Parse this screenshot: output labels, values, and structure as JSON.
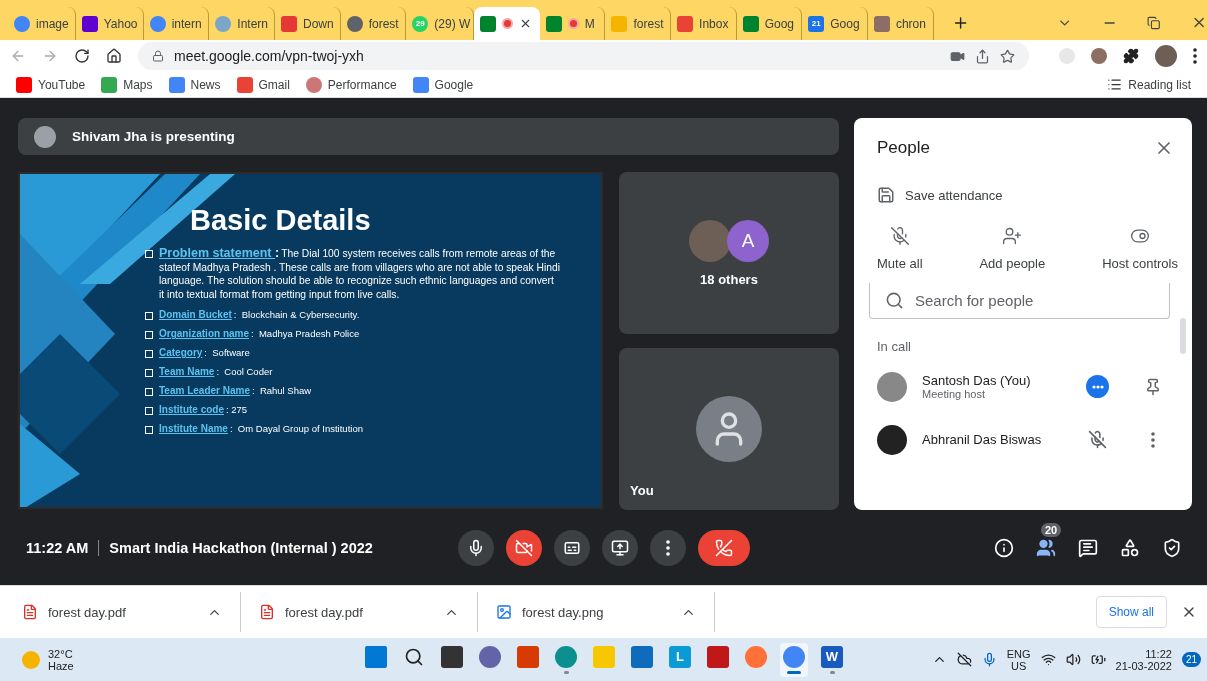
{
  "browser": {
    "tabs": [
      {
        "label": "image",
        "selected": false,
        "recording": false
      },
      {
        "label": "Yahoo",
        "selected": false,
        "recording": false
      },
      {
        "label": "intern",
        "selected": false,
        "recording": false
      },
      {
        "label": "Intern",
        "selected": false,
        "recording": false
      },
      {
        "label": "Down",
        "selected": false,
        "recording": false
      },
      {
        "label": "forest",
        "selected": false,
        "recording": false
      },
      {
        "label": "(29) W",
        "favicon_text": "29",
        "selected": false,
        "recording": false
      },
      {
        "selected": true,
        "recording": true
      },
      {
        "label": "M",
        "selected": false,
        "recording": true
      },
      {
        "label": "forest",
        "selected": false,
        "recording": false
      },
      {
        "label": "Inbox",
        "selected": false,
        "recording": false
      },
      {
        "label": "Goog",
        "selected": false,
        "recording": false
      },
      {
        "label": "Goog",
        "favicon_text": "21",
        "selected": false,
        "recording": false
      },
      {
        "label": "chron",
        "selected": false,
        "recording": false
      }
    ],
    "url": "meet.google.com/vpn-twoj-yxh",
    "bookmarks": [
      {
        "label": "YouTube"
      },
      {
        "label": "Maps"
      },
      {
        "label": "News"
      },
      {
        "label": "Gmail"
      },
      {
        "label": "Performance"
      },
      {
        "label": "Google"
      }
    ],
    "reading_list": "Reading list"
  },
  "meet": {
    "presenter_bar": "Shivam Jha is presenting",
    "slide": {
      "title": "Basic Details",
      "problem_label": "Problem statement ",
      "problem_sep": ":",
      "problem_text": "The Dial 100 system receives calls from remote areas of the stateof Madhya Pradesh . These calls are from villagers who are not able to speak Hindi language. The solution should be able to recognize such ethnic languages and convert it into textual format from getting input from live calls.",
      "fields": [
        {
          "label": "Domain Bucket",
          "value": ":  Blockchain & Cybersecurity."
        },
        {
          "label": "Organization name",
          "value": ":  Madhya Pradesh Police"
        },
        {
          "label": "Category",
          "value": ":  Software"
        },
        {
          "label": "Team Name",
          "value": ":  Cool Coder"
        },
        {
          "label": "Team Leader Name ",
          "value": ":  Rahul Shaw"
        },
        {
          "label": "Institute code",
          "value": ": 275"
        },
        {
          "label": "Institute Name",
          "value": ":  Om Dayal Group of Institution"
        }
      ]
    },
    "tiles": [
      {
        "kind": "group",
        "avatar_letter": "A",
        "caption": "18 others"
      },
      {
        "kind": "self",
        "caption": "You"
      }
    ],
    "people": {
      "title": "People",
      "save_attendance": "Save attendance",
      "actions": [
        {
          "kind": "mute",
          "label": "Mute all"
        },
        {
          "kind": "add",
          "label": "Add people"
        },
        {
          "kind": "host",
          "label": "Host controls"
        }
      ],
      "search_placeholder": "Search for people",
      "section": "In call",
      "participants": [
        {
          "name": "Santosh Das (You)",
          "subtitle": "Meeting host",
          "muted": false
        },
        {
          "name": "Abhranil Das Biswas",
          "muted": true
        }
      ]
    },
    "bottom_bar": {
      "time": "11:22 AM",
      "title": "Smart India Hackathon (Internal ) 2022",
      "controls": [
        {
          "kind": "mic",
          "off": false
        },
        {
          "kind": "camera",
          "off": true
        },
        {
          "kind": "captions"
        },
        {
          "kind": "present"
        },
        {
          "kind": "more"
        },
        {
          "kind": "leave"
        }
      ],
      "side": [
        {
          "kind": "info",
          "selected": false
        },
        {
          "kind": "people",
          "selected": true,
          "badge": "20"
        },
        {
          "kind": "chat",
          "selected": false
        },
        {
          "kind": "activities",
          "selected": false
        },
        {
          "kind": "safety",
          "selected": false
        }
      ]
    }
  },
  "downloads": {
    "items": [
      {
        "name": "forest day.pdf",
        "kind": "pdf"
      },
      {
        "name": "forest day.pdf",
        "kind": "pdf"
      },
      {
        "name": "forest day.png",
        "kind": "image"
      }
    ],
    "show_all": "Show all"
  },
  "taskbar": {
    "weather": {
      "temp": "32°C",
      "condition": "Haze"
    },
    "apps": [
      {
        "kind": "start",
        "running": false,
        "selected": false
      },
      {
        "kind": "search",
        "running": false,
        "selected": false
      },
      {
        "kind": "taskview",
        "running": false,
        "selected": false
      },
      {
        "kind": "chat",
        "running": false,
        "selected": false
      },
      {
        "kind": "office",
        "running": false,
        "selected": false
      },
      {
        "kind": "edge",
        "running": true,
        "selected": false
      },
      {
        "kind": "files",
        "running": false,
        "selected": false
      },
      {
        "kind": "mail",
        "running": false,
        "selected": false
      },
      {
        "kind": "letter",
        "glyph": "L",
        "running": false,
        "selected": false
      },
      {
        "kind": "shield",
        "running": false,
        "selected": false
      },
      {
        "kind": "firefox",
        "running": false,
        "selected": false
      },
      {
        "kind": "chrome",
        "running": true,
        "selected": true
      },
      {
        "kind": "word",
        "glyph": "W",
        "running": true,
        "selected": false
      }
    ],
    "lang": "ENG",
    "region": "US",
    "time": "11:22",
    "date": "21-03-2022",
    "notifications": "21"
  }
}
